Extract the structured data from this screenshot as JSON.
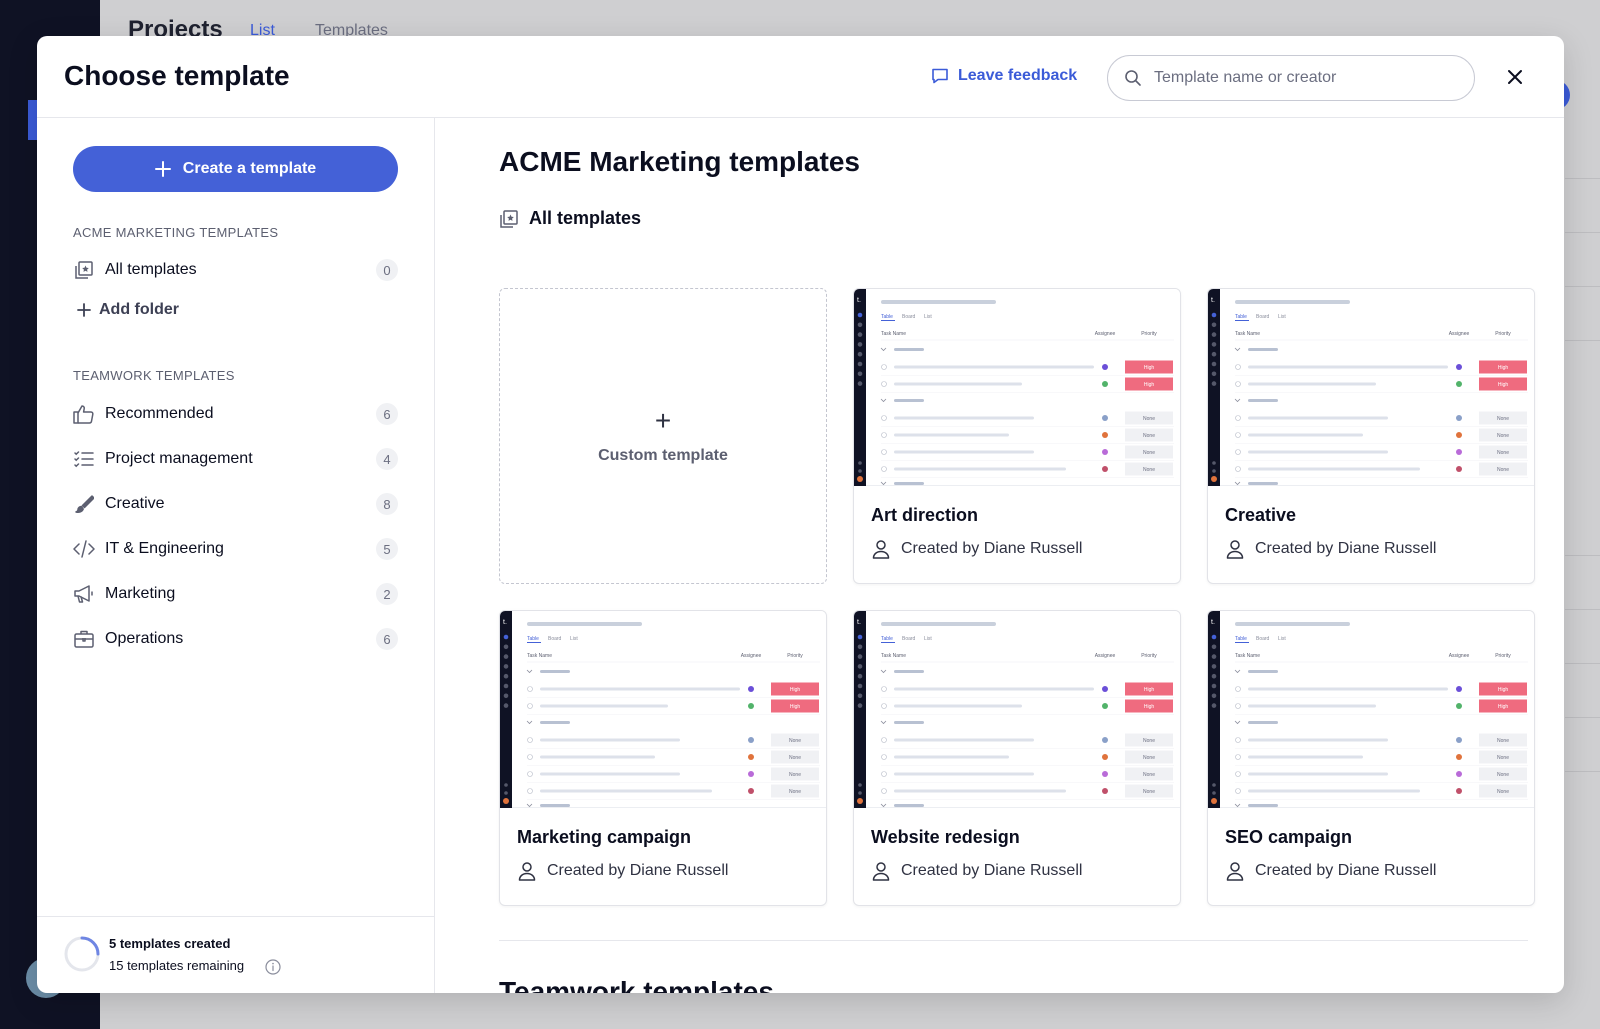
{
  "background": {
    "page_title": "Projects",
    "tabs": [
      "List",
      "Templates"
    ]
  },
  "modal": {
    "title": "Choose template",
    "feedback_label": "Leave feedback",
    "search_placeholder": "Template name or creator"
  },
  "sidebar": {
    "create_label": "Create a template",
    "acme_section": "ACME MARKETING TEMPLATES",
    "acme_items": [
      {
        "label": "All templates",
        "count": "0",
        "icon": "template-star-icon"
      }
    ],
    "add_folder_label": "Add folder",
    "teamwork_section": "TEAMWORK TEMPLATES",
    "teamwork_items": [
      {
        "label": "Recommended",
        "count": "6",
        "icon": "thumbs-up-icon"
      },
      {
        "label": "Project management",
        "count": "4",
        "icon": "list-check-icon"
      },
      {
        "label": "Creative",
        "count": "8",
        "icon": "brush-icon"
      },
      {
        "label": "IT & Engineering",
        "count": "5",
        "icon": "code-icon"
      },
      {
        "label": "Marketing",
        "count": "2",
        "icon": "megaphone-icon"
      },
      {
        "label": "Operations",
        "count": "6",
        "icon": "briefcase-icon"
      }
    ],
    "footer": {
      "created": "5 templates created",
      "remaining": "15 templates remaining",
      "used_fraction": 0.25
    }
  },
  "main": {
    "title": "ACME Marketing templates",
    "subtitle": "All templates",
    "custom_template_label": "Custom template",
    "cards": [
      {
        "name": "Art direction",
        "creator": "Created by Diane Russell"
      },
      {
        "name": "Creative",
        "creator": "Created by Diane Russell"
      },
      {
        "name": "Marketing campaign",
        "creator": "Created by Diane Russell"
      },
      {
        "name": "Website redesign",
        "creator": "Created by Diane Russell"
      },
      {
        "name": "SEO campaign",
        "creator": "Created by Diane Russell"
      }
    ],
    "thumbnail": {
      "tabs": [
        "Table",
        "Board",
        "List"
      ],
      "col_task": "Task Name",
      "col_assignee": "Assignee",
      "col_priority": "Priority",
      "priority_high": "High",
      "priority_none": "None"
    },
    "teamwork_title": "Teamwork templates"
  },
  "colors": {
    "accent": "#4461d7",
    "high": "#ef6b7f",
    "rail": "#0f1224"
  }
}
